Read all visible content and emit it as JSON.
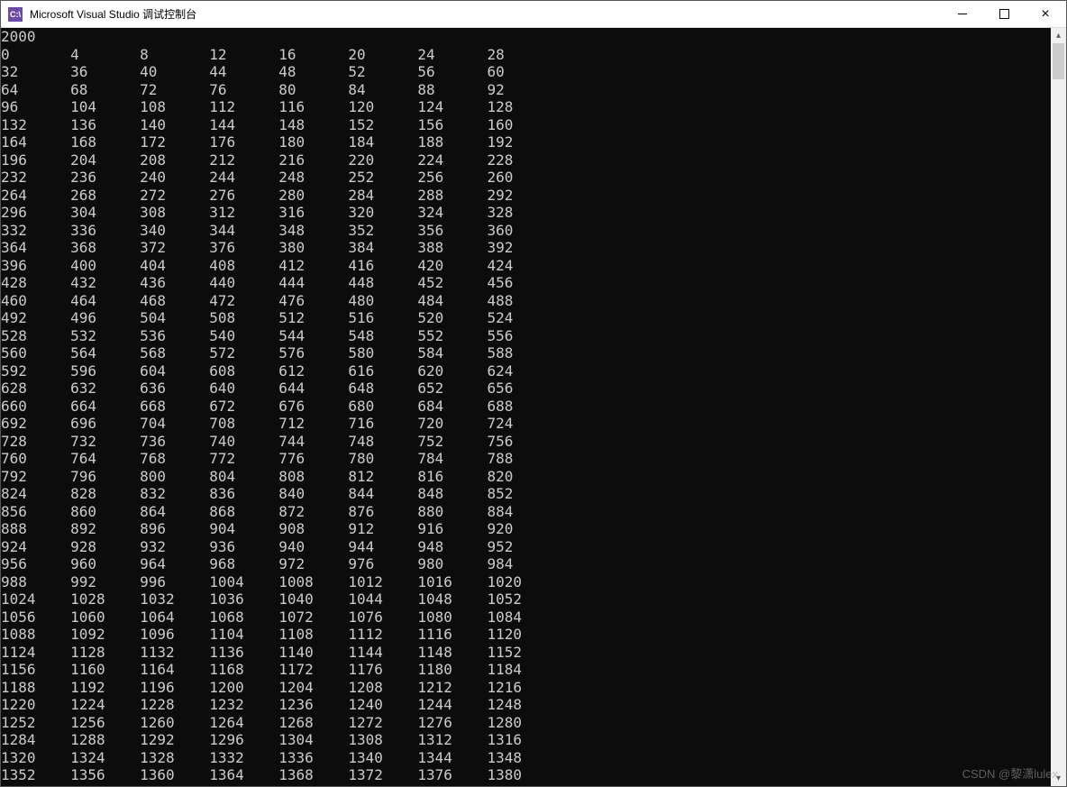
{
  "window": {
    "icon_text": "C:\\",
    "title": "Microsoft Visual Studio 调试控制台"
  },
  "console": {
    "first_line": "2000",
    "columns": 8,
    "cell_width_chars": 8,
    "rows": [
      [
        0,
        4,
        8,
        12,
        16,
        20,
        24,
        28
      ],
      [
        32,
        36,
        40,
        44,
        48,
        52,
        56,
        60
      ],
      [
        64,
        68,
        72,
        76,
        80,
        84,
        88,
        92
      ],
      [
        96,
        104,
        108,
        112,
        116,
        120,
        124,
        128
      ],
      [
        132,
        136,
        140,
        144,
        148,
        152,
        156,
        160
      ],
      [
        164,
        168,
        172,
        176,
        180,
        184,
        188,
        192
      ],
      [
        196,
        204,
        208,
        212,
        216,
        220,
        224,
        228
      ],
      [
        232,
        236,
        240,
        244,
        248,
        252,
        256,
        260
      ],
      [
        264,
        268,
        272,
        276,
        280,
        284,
        288,
        292
      ],
      [
        296,
        304,
        308,
        312,
        316,
        320,
        324,
        328
      ],
      [
        332,
        336,
        340,
        344,
        348,
        352,
        356,
        360
      ],
      [
        364,
        368,
        372,
        376,
        380,
        384,
        388,
        392
      ],
      [
        396,
        400,
        404,
        408,
        412,
        416,
        420,
        424
      ],
      [
        428,
        432,
        436,
        440,
        444,
        448,
        452,
        456
      ],
      [
        460,
        464,
        468,
        472,
        476,
        480,
        484,
        488
      ],
      [
        492,
        496,
        504,
        508,
        512,
        516,
        520,
        524
      ],
      [
        528,
        532,
        536,
        540,
        544,
        548,
        552,
        556
      ],
      [
        560,
        564,
        568,
        572,
        576,
        580,
        584,
        588
      ],
      [
        592,
        596,
        604,
        608,
        612,
        616,
        620,
        624
      ],
      [
        628,
        632,
        636,
        640,
        644,
        648,
        652,
        656
      ],
      [
        660,
        664,
        668,
        672,
        676,
        680,
        684,
        688
      ],
      [
        692,
        696,
        704,
        708,
        712,
        716,
        720,
        724
      ],
      [
        728,
        732,
        736,
        740,
        744,
        748,
        752,
        756
      ],
      [
        760,
        764,
        768,
        772,
        776,
        780,
        784,
        788
      ],
      [
        792,
        796,
        800,
        804,
        808,
        812,
        816,
        820
      ],
      [
        824,
        828,
        832,
        836,
        840,
        844,
        848,
        852
      ],
      [
        856,
        860,
        864,
        868,
        872,
        876,
        880,
        884
      ],
      [
        888,
        892,
        896,
        904,
        908,
        912,
        916,
        920
      ],
      [
        924,
        928,
        932,
        936,
        940,
        944,
        948,
        952
      ],
      [
        956,
        960,
        964,
        968,
        972,
        976,
        980,
        984
      ],
      [
        988,
        992,
        996,
        1004,
        1008,
        1012,
        1016,
        1020
      ],
      [
        1024,
        1028,
        1032,
        1036,
        1040,
        1044,
        1048,
        1052
      ],
      [
        1056,
        1060,
        1064,
        1068,
        1072,
        1076,
        1080,
        1084
      ],
      [
        1088,
        1092,
        1096,
        1104,
        1108,
        1112,
        1116,
        1120
      ],
      [
        1124,
        1128,
        1132,
        1136,
        1140,
        1144,
        1148,
        1152
      ],
      [
        1156,
        1160,
        1164,
        1168,
        1172,
        1176,
        1180,
        1184
      ],
      [
        1188,
        1192,
        1196,
        1200,
        1204,
        1208,
        1212,
        1216
      ],
      [
        1220,
        1224,
        1228,
        1232,
        1236,
        1240,
        1244,
        1248
      ],
      [
        1252,
        1256,
        1260,
        1264,
        1268,
        1272,
        1276,
        1280
      ],
      [
        1284,
        1288,
        1292,
        1296,
        1304,
        1308,
        1312,
        1316
      ],
      [
        1320,
        1324,
        1328,
        1332,
        1336,
        1340,
        1344,
        1348
      ],
      [
        1352,
        1356,
        1360,
        1364,
        1368,
        1372,
        1376,
        1380
      ]
    ]
  },
  "watermark": "CSDN @黎潇lulex"
}
